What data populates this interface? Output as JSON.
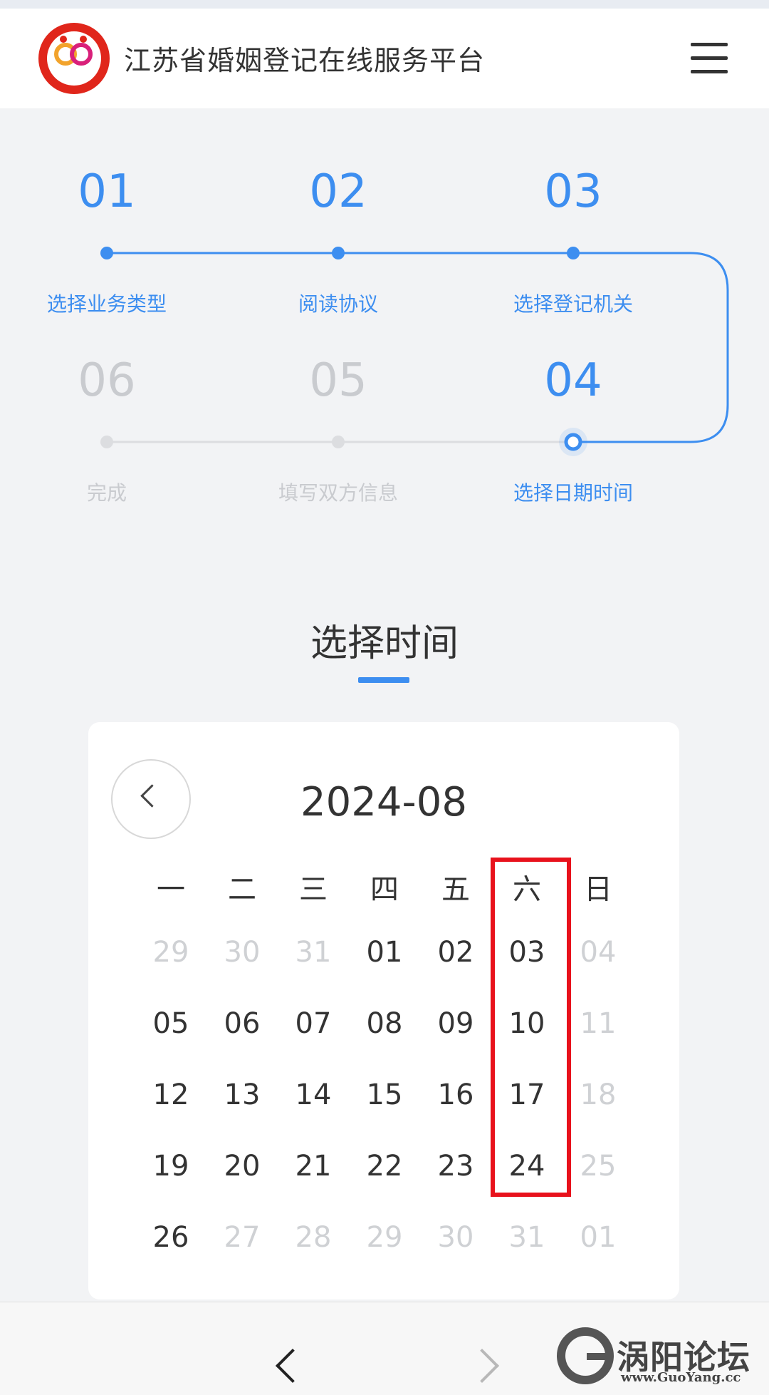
{
  "header": {
    "site_title": "江苏省婚姻登记在线服务平台",
    "logo_icon": "marriage-registration-logo",
    "menu_icon": "hamburger-menu-icon"
  },
  "steps": [
    {
      "num": "01",
      "label": "选择业务类型",
      "state": "done"
    },
    {
      "num": "02",
      "label": "阅读协议",
      "state": "done"
    },
    {
      "num": "03",
      "label": "选择登记机关",
      "state": "done"
    },
    {
      "num": "04",
      "label": "选择日期时间",
      "state": "current"
    },
    {
      "num": "05",
      "label": "填写双方信息",
      "state": "pending"
    },
    {
      "num": "06",
      "label": "完成",
      "state": "pending"
    }
  ],
  "section": {
    "title": "选择时间"
  },
  "calendar": {
    "month": "2024-08",
    "weekdays": [
      "一",
      "二",
      "三",
      "四",
      "五",
      "六",
      "日"
    ],
    "weeks": [
      [
        {
          "d": "29",
          "cur": false
        },
        {
          "d": "30",
          "cur": false
        },
        {
          "d": "31",
          "cur": false
        },
        {
          "d": "01",
          "cur": true
        },
        {
          "d": "02",
          "cur": true
        },
        {
          "d": "03",
          "cur": true
        },
        {
          "d": "04",
          "cur": false
        }
      ],
      [
        {
          "d": "05",
          "cur": true
        },
        {
          "d": "06",
          "cur": true
        },
        {
          "d": "07",
          "cur": true
        },
        {
          "d": "08",
          "cur": true
        },
        {
          "d": "09",
          "cur": true
        },
        {
          "d": "10",
          "cur": true
        },
        {
          "d": "11",
          "cur": false
        }
      ],
      [
        {
          "d": "12",
          "cur": true
        },
        {
          "d": "13",
          "cur": true
        },
        {
          "d": "14",
          "cur": true
        },
        {
          "d": "15",
          "cur": true
        },
        {
          "d": "16",
          "cur": true
        },
        {
          "d": "17",
          "cur": true
        },
        {
          "d": "18",
          "cur": false
        }
      ],
      [
        {
          "d": "19",
          "cur": true
        },
        {
          "d": "20",
          "cur": true
        },
        {
          "d": "21",
          "cur": true
        },
        {
          "d": "22",
          "cur": true
        },
        {
          "d": "23",
          "cur": true
        },
        {
          "d": "24",
          "cur": true
        },
        {
          "d": "25",
          "cur": false
        }
      ],
      [
        {
          "d": "26",
          "cur": true
        },
        {
          "d": "27",
          "cur": false
        },
        {
          "d": "28",
          "cur": false
        },
        {
          "d": "29",
          "cur": false
        },
        {
          "d": "30",
          "cur": false
        },
        {
          "d": "31",
          "cur": false
        },
        {
          "d": "01",
          "cur": false
        }
      ]
    ],
    "highlight_color": "#e8121c"
  },
  "colors": {
    "accent": "#3d8ef0",
    "muted": "#c9cbcf",
    "text": "#333333"
  },
  "bottom_nav": {
    "back_icon": "chevron-left-icon",
    "forward_icon": "chevron-right-icon"
  },
  "watermark": {
    "name": "涡阳论坛",
    "url": "www.GuoYang.cc"
  }
}
